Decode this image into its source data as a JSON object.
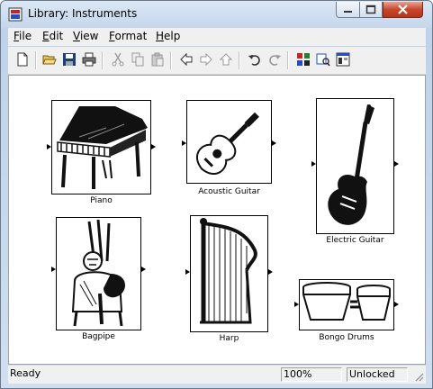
{
  "window": {
    "title": "Library: Instruments"
  },
  "menu": [
    "File",
    "Edit",
    "View",
    "Format",
    "Help"
  ],
  "toolbar": {
    "icons": [
      "new-icon",
      "open-icon",
      "save-icon",
      "print-icon",
      "cut-icon",
      "copy-icon",
      "paste-icon",
      "back-icon",
      "forward-icon",
      "up-icon",
      "undo-icon",
      "redo-icon",
      "library-browser-icon",
      "model-explorer-icon",
      "debugger-icon"
    ]
  },
  "blocks": [
    {
      "name": "Piano"
    },
    {
      "name": "Acoustic Guitar"
    },
    {
      "name": "Electric Guitar"
    },
    {
      "name": "Bagpipe"
    },
    {
      "name": "Harp"
    },
    {
      "name": "Bongo Drums"
    }
  ],
  "status": {
    "text": "Ready",
    "zoom": "100%",
    "lock": "Unlocked"
  }
}
